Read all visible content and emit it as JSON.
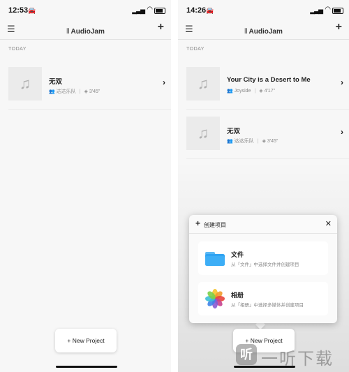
{
  "app_title": "AudioJam",
  "left": {
    "time": "12:53",
    "section": "TODAY",
    "songs": [
      {
        "title": "无双",
        "artist": "达达乐队",
        "duration": "3'45\""
      }
    ],
    "new_project_label": "+ New Project"
  },
  "right": {
    "time": "14:26",
    "section": "TODAY",
    "songs": [
      {
        "title": "Your City is a Desert to Me",
        "artist": "Joyside",
        "duration": "4'17\""
      },
      {
        "title": "无双",
        "artist": "达达乐队",
        "duration": "3'45\""
      }
    ],
    "new_project_label": "+ New Project",
    "popup": {
      "title": "创建项目",
      "options": [
        {
          "label": "文件",
          "description": "从「文件」中选择文件并创建项目",
          "icon": "folder-icon"
        },
        {
          "label": "相册",
          "description": "从「相册」中选择多媒体并创建项目",
          "icon": "photos-icon"
        }
      ]
    }
  },
  "watermark": {
    "text": "一听下载",
    "logo_glyph": "听"
  },
  "colors": {
    "background": "#f7f7f7",
    "folder": "#2ea3f2",
    "divider": "#e3e3e3"
  }
}
